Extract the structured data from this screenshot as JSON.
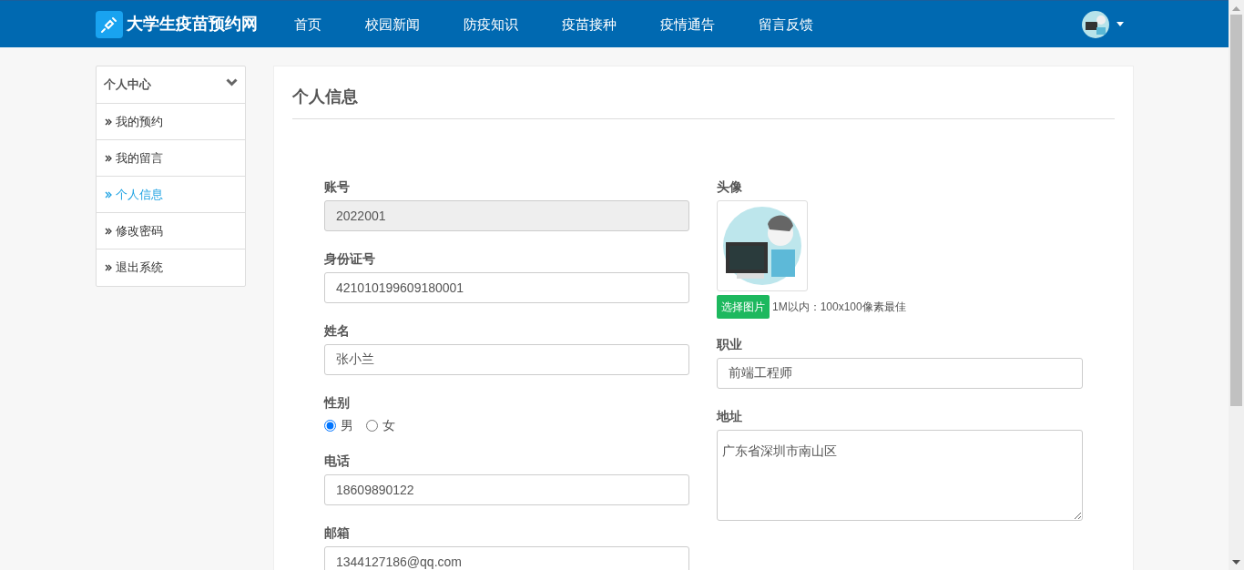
{
  "header": {
    "brand": "大学生疫苗预约网",
    "nav": [
      {
        "label": "首页",
        "selected": false
      },
      {
        "label": "校园新闻",
        "selected": false
      },
      {
        "label": "防疫知识",
        "selected": false
      },
      {
        "label": "疫苗接种",
        "selected": false
      },
      {
        "label": "疫情通告",
        "selected": false
      },
      {
        "label": "留言反馈",
        "selected": false
      }
    ]
  },
  "sidebar": {
    "title": "个人中心",
    "items": [
      {
        "label": "我的预约",
        "selected": false
      },
      {
        "label": "我的留言",
        "selected": false
      },
      {
        "label": "个人信息",
        "selected": true
      },
      {
        "label": "修改密码",
        "selected": false
      },
      {
        "label": "退出系统",
        "selected": false
      }
    ]
  },
  "panel": {
    "title": "个人信息"
  },
  "form": {
    "left": [
      {
        "kind": "input",
        "label": "账号",
        "value": "2022001",
        "disabled": true
      },
      {
        "kind": "input",
        "label": "身份证号",
        "value": "421010199609180001",
        "disabled": false
      },
      {
        "kind": "input",
        "label": "姓名",
        "value": "张小兰",
        "disabled": false
      },
      {
        "kind": "radio",
        "label": "性别",
        "options": [
          {
            "label": "男",
            "selected": true
          },
          {
            "label": "女",
            "selected": false
          }
        ]
      },
      {
        "kind": "input",
        "label": "电话",
        "value": "18609890122",
        "disabled": false
      },
      {
        "kind": "input",
        "label": "邮箱",
        "value": "1344127186@qq.com",
        "disabled": false
      }
    ],
    "right": [
      {
        "kind": "avatar",
        "label": "头像",
        "button": "选择图片",
        "hint": "1M以内：100x100像素最佳"
      },
      {
        "kind": "input",
        "label": "职业",
        "value": "前端工程师",
        "disabled": false
      },
      {
        "kind": "textarea",
        "label": "地址",
        "value": "广东省深圳市南山区"
      }
    ]
  }
}
